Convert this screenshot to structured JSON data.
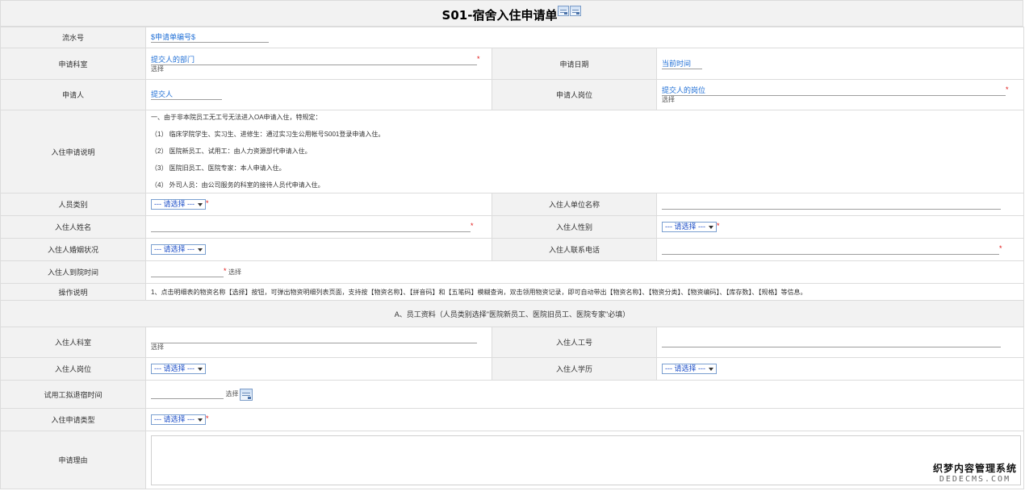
{
  "header": {
    "title": "S01-宿舍入住申请单",
    "icons": [
      "doc-icon",
      "doc-icon"
    ]
  },
  "form": {
    "serial": {
      "label": "流水号",
      "value": "$申请单编号$"
    },
    "dept": {
      "label": "申请科室",
      "value": "提交人的部门",
      "hint": "选择"
    },
    "apply_date": {
      "label": "申请日期",
      "value": "当前时间"
    },
    "applicant": {
      "label": "申请人",
      "value": "提交人"
    },
    "applicant_post": {
      "label": "申请人岗位",
      "value": "提交人的岗位",
      "hint": "选择"
    },
    "instructions": {
      "label": "入住申请说明",
      "lines": [
        "一、由于非本院员工无工号无法进入OA申请入住，特规定：",
        "（1）  临床学院学生、实习生、进修生：通过实习生公用帐号S001登录申请入住。",
        "（2）  医院新员工、试用工：由人力资源部代申请入住。",
        "（3）  医院旧员工、医院专家：本人申请入住。",
        "（4）  外司人员：由公司服务的科室的接待人员代申请入住。"
      ]
    },
    "person_type": {
      "label": "人员类别",
      "select": "--- 请选择 ---"
    },
    "unit_name": {
      "label": "入住人单位名称"
    },
    "occupant_name": {
      "label": "入住人姓名"
    },
    "occupant_gender": {
      "label": "入住人性别",
      "select": "--- 请选择 ---"
    },
    "marital": {
      "label": "入住人婚姻状况",
      "select": "--- 请选择 ---"
    },
    "phone": {
      "label": "入住人联系电话"
    },
    "arrival_time": {
      "label": "入住人到院时间",
      "hint": "选择"
    },
    "operation": {
      "label": "操作说明",
      "text": "1、点击明细表的物资名称【选择】按钮，可弹出物资明细列表页面，支持按【物资名称】、【拼音码】和【五笔码】模糊查询，双击领用物资记录，即可自动带出【物资名称】、【物资分类】、【物资编码】、【库存数】、【规格】等信息。"
    },
    "section_a": {
      "title": "A、员工资料（人员类别选择\"医院新员工、医院旧员工、医院专家\"必填）"
    },
    "occupant_dept": {
      "label": "入住人科室",
      "hint": "选择"
    },
    "occupant_id": {
      "label": "入住人工号"
    },
    "occupant_post": {
      "label": "入住人岗位",
      "select": "--- 请选择 ---"
    },
    "occupant_edu": {
      "label": "入住人学历",
      "select": "--- 请选择 ---"
    },
    "trial_time": {
      "label": "试用工拟退宿时间",
      "hint": "选择"
    },
    "apply_type": {
      "label": "入住申请类型",
      "select": "--- 请选择 ---"
    },
    "reason": {
      "label": "申请理由"
    },
    "required_mark": "*"
  },
  "watermark": {
    "line1": "织梦内容管理系统",
    "line2": "DEDECMS.COM"
  },
  "colors": {
    "label_bg": "#f2f2f2",
    "border": "#dcdcdc",
    "link_blue": "#1f6fd6",
    "required": "#e01010"
  }
}
